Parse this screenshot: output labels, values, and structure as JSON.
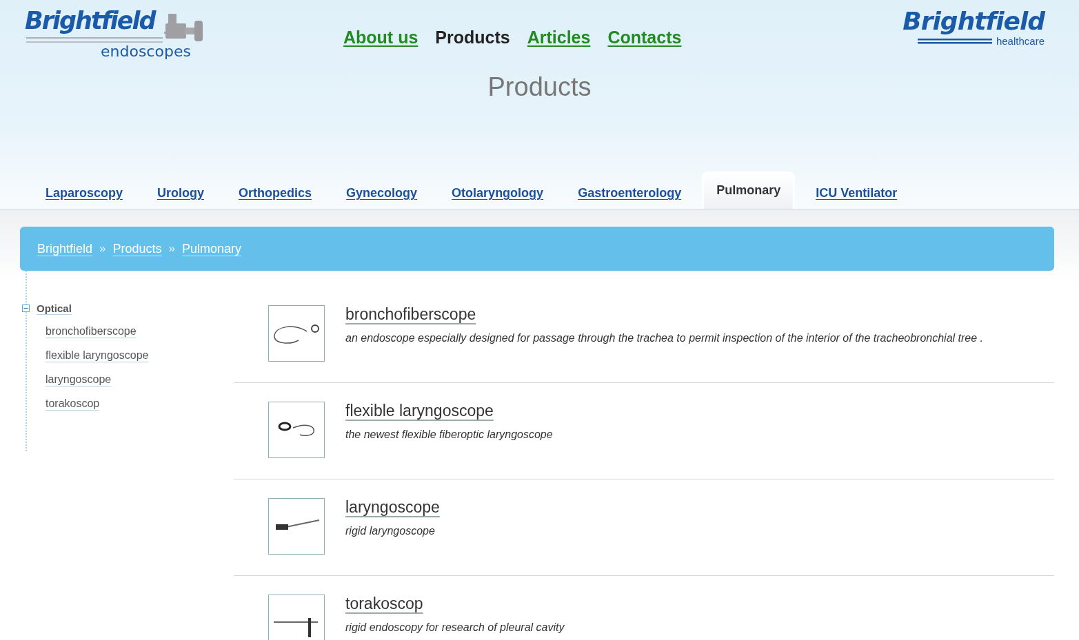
{
  "logo_left": {
    "name": "Brightfield",
    "tagline": "endoscopes"
  },
  "main_nav": [
    {
      "label": "About us",
      "selected": false
    },
    {
      "label": "Products",
      "selected": true
    },
    {
      "label": "Articles",
      "selected": false
    },
    {
      "label": "Contacts",
      "selected": false
    }
  ],
  "logo_right": {
    "name": "Brightfield",
    "tagline": "healthcare"
  },
  "page_title": "Products",
  "category_tabs": [
    {
      "label": "Laparoscopy",
      "selected": false
    },
    {
      "label": "Urology",
      "selected": false
    },
    {
      "label": "Orthopedics",
      "selected": false
    },
    {
      "label": "Gynecology",
      "selected": false
    },
    {
      "label": "Otolaryngology",
      "selected": false
    },
    {
      "label": "Gastroenterology",
      "selected": false
    },
    {
      "label": "Pulmonary",
      "selected": true
    },
    {
      "label": "ICU Ventilator",
      "selected": false
    }
  ],
  "breadcrumb": {
    "separator": "»",
    "items": [
      "Brightfield",
      "Products",
      "Pulmonary"
    ]
  },
  "sidebar_tree": [
    {
      "label": "Optical",
      "expanded": true,
      "children": [
        {
          "label": "bronchofiberscope"
        },
        {
          "label": "flexible laryngoscope"
        },
        {
          "label": "laryngoscope"
        },
        {
          "label": "torakoscop"
        }
      ]
    }
  ],
  "products": [
    {
      "name": "bronchofiberscope",
      "description": "an endoscope especially designed for passage through the trachea to permit inspection of the interior of the tracheobronchial tree ."
    },
    {
      "name": "flexible laryngoscope",
      "description": "the newest flexible fiberoptic laryngoscope"
    },
    {
      "name": "laryngoscope",
      "description": "rigid laryngoscope"
    },
    {
      "name": "torakoscop",
      "description": "rigid endoscopy for research of pleural cavity"
    }
  ]
}
